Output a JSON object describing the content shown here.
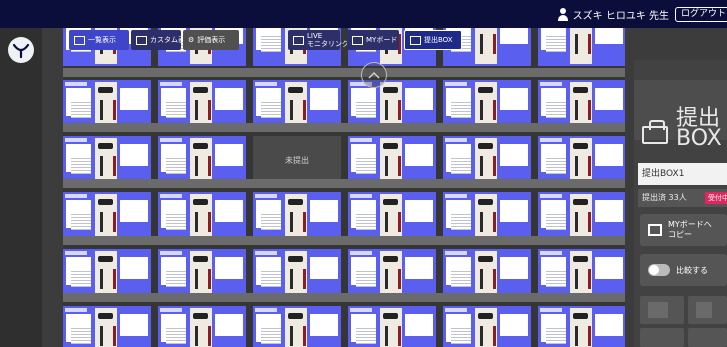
{
  "header": {
    "user_name": "スズキ ヒロユキ 先生",
    "logout_label": "ログアウト"
  },
  "toolbar": {
    "list_view": "一覧表示",
    "custom_view": "カスタム表示",
    "eval_view": "評価表示",
    "live_line1": "LIVE",
    "live_line2": "モニタリング",
    "myboard": "MYボード",
    "submit_box": "提出BOX"
  },
  "board": {
    "empty_label": "未提出"
  },
  "side_panel": {
    "title_line1": "提出",
    "title_line2": "BOX",
    "box_name": "提出BOX1",
    "submitted": "提出済 33人",
    "status_badge": "受付中",
    "copy_line1": "MYボードへ",
    "copy_line2": "コピー",
    "compare_label": "比較する"
  },
  "colors": {
    "header_bg": "#0b0e3a",
    "card_bg": "#5a5ff0",
    "active_tab": "#3e45c8",
    "badge": "#e4245e"
  }
}
